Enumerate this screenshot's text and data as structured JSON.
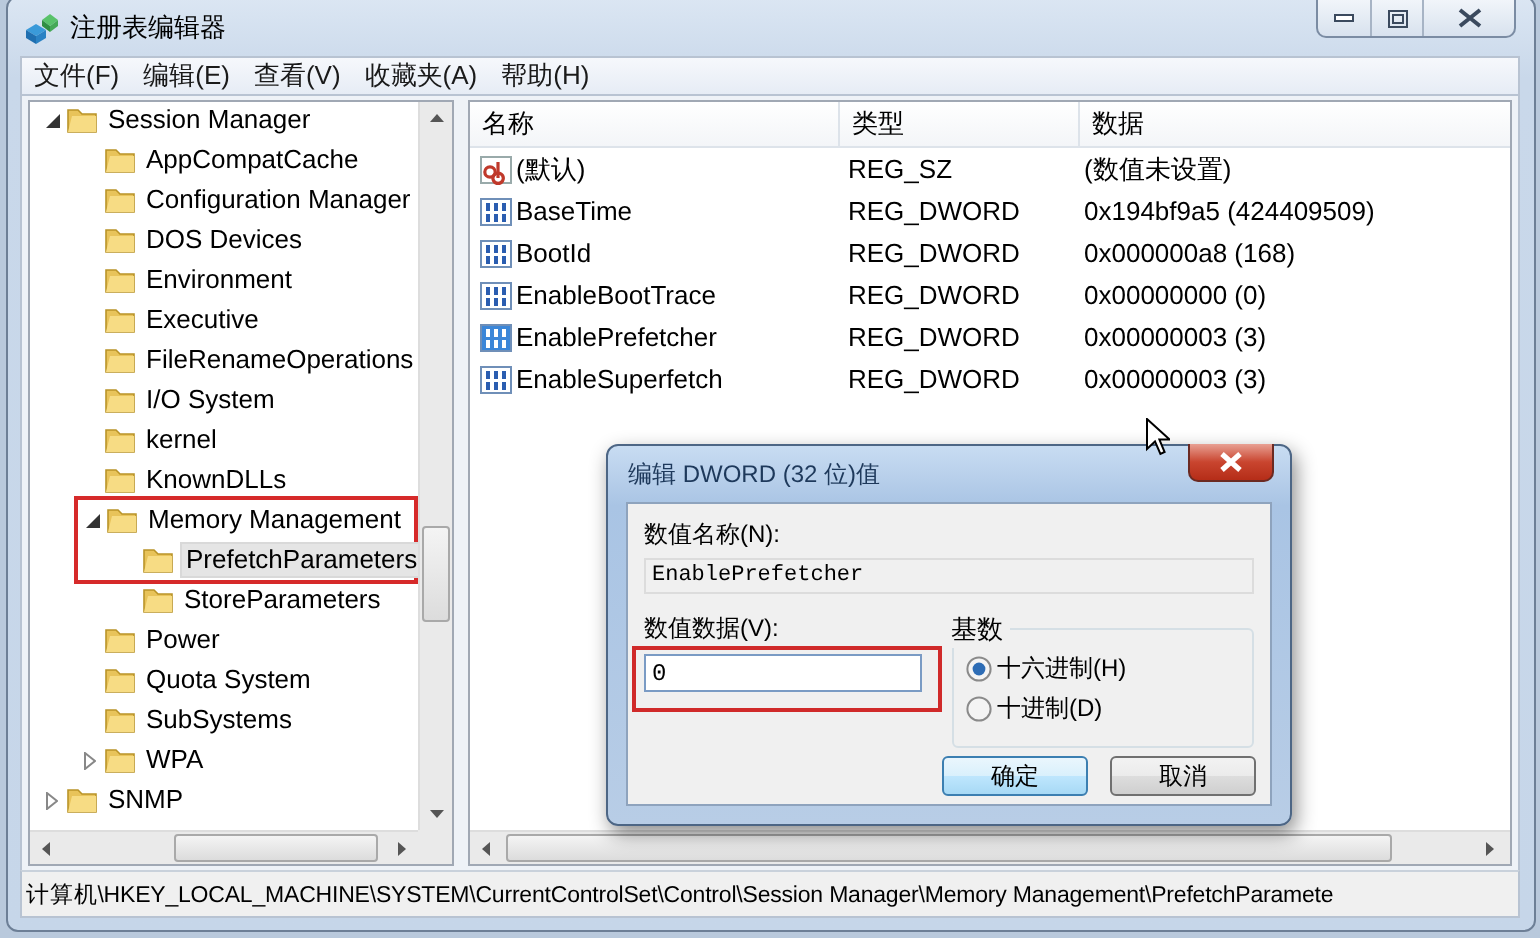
{
  "window": {
    "title": "注册表编辑器"
  },
  "menu": [
    "文件(F)",
    "编辑(E)",
    "查看(V)",
    "收藏夹(A)",
    "帮助(H)"
  ],
  "tree": [
    {
      "label": "Session Manager",
      "kind": "branch",
      "expanded": true,
      "selected": false,
      "framed": false,
      "children": [
        {
          "label": "AppCompatCache",
          "kind": "leaf",
          "selected": false,
          "framed": false
        },
        {
          "label": "Configuration Manager",
          "kind": "leaf",
          "selected": false,
          "framed": false
        },
        {
          "label": "DOS Devices",
          "kind": "leaf",
          "selected": false,
          "framed": false
        },
        {
          "label": "Environment",
          "kind": "leaf",
          "selected": false,
          "framed": false
        },
        {
          "label": "Executive",
          "kind": "leaf",
          "selected": false,
          "framed": false
        },
        {
          "label": "FileRenameOperations",
          "kind": "leaf",
          "selected": false,
          "framed": false
        },
        {
          "label": "I/O System",
          "kind": "leaf",
          "selected": false,
          "framed": false
        },
        {
          "label": "kernel",
          "kind": "leaf",
          "selected": false,
          "framed": false
        },
        {
          "label": "KnownDLLs",
          "kind": "leaf",
          "selected": false,
          "framed": false
        },
        {
          "label": "Memory Management",
          "kind": "branch",
          "expanded": true,
          "selected": false,
          "framed": true,
          "children": [
            {
              "label": "PrefetchParameters",
              "kind": "leaf",
              "selected": true,
              "framed": true
            },
            {
              "label": "StoreParameters",
              "kind": "leaf",
              "selected": false,
              "framed": false
            }
          ]
        },
        {
          "label": "Power",
          "kind": "leaf",
          "selected": false,
          "framed": false
        },
        {
          "label": "Quota System",
          "kind": "leaf",
          "selected": false,
          "framed": false
        },
        {
          "label": "SubSystems",
          "kind": "leaf",
          "selected": false,
          "framed": false
        },
        {
          "label": "WPA",
          "kind": "branch",
          "expanded": false,
          "selected": false,
          "framed": false
        }
      ]
    },
    {
      "label": "SNMP",
      "kind": "branch",
      "expanded": false,
      "selected": false,
      "framed": false
    }
  ],
  "table": {
    "columns": [
      "名称",
      "类型",
      "数据"
    ],
    "rows": [
      {
        "kind": "string",
        "name": "(默认)",
        "type": "REG_SZ",
        "data": "(数值未设置)",
        "selected": false
      },
      {
        "kind": "dword",
        "name": "BaseTime",
        "type": "REG_DWORD",
        "data": "0x194bf9a5 (424409509)",
        "selected": false
      },
      {
        "kind": "dword",
        "name": "BootId",
        "type": "REG_DWORD",
        "data": "0x000000a8 (168)",
        "selected": false
      },
      {
        "kind": "dword",
        "name": "EnableBootTrace",
        "type": "REG_DWORD",
        "data": "0x00000000 (0)",
        "selected": false
      },
      {
        "kind": "dword",
        "name": "EnablePrefetcher",
        "type": "REG_DWORD",
        "data": "0x00000003 (3)",
        "selected": true
      },
      {
        "kind": "dword",
        "name": "EnableSuperfetch",
        "type": "REG_DWORD",
        "data": "0x00000003 (3)",
        "selected": false
      }
    ]
  },
  "status_bar": "计算机\\HKEY_LOCAL_MACHINE\\SYSTEM\\CurrentControlSet\\Control\\Session Manager\\Memory Management\\PrefetchParamete",
  "dialog": {
    "title": "编辑 DWORD (32 位)值",
    "name_label": "数值名称(N):",
    "name_value": "EnablePrefetcher",
    "data_label": "数值数据(V):",
    "data_field": {
      "value": "0",
      "framed": true
    },
    "base": {
      "title": "基数",
      "options": [
        {
          "label": "十六进制(H)",
          "selected": true
        },
        {
          "label": "十进制(D)",
          "selected": false
        }
      ]
    },
    "buttons": [
      {
        "label": "确定",
        "default": true
      },
      {
        "label": "取消",
        "default": false
      }
    ]
  }
}
